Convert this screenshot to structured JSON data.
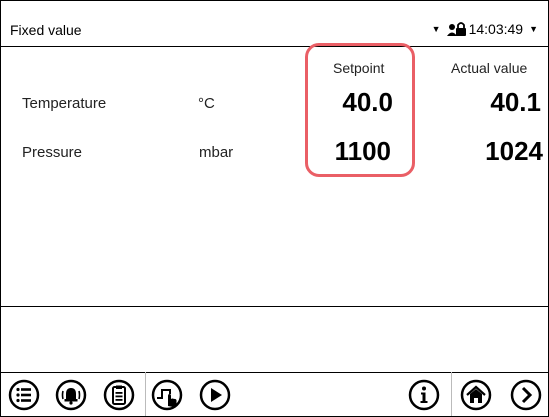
{
  "header": {
    "title": "Fixed value",
    "time": "14:03:49"
  },
  "table": {
    "col_setpoint": "Setpoint",
    "col_actual": "Actual value",
    "rows": [
      {
        "label": "Temperature",
        "unit": "°C",
        "setpoint": "40.0",
        "actual": "40.1"
      },
      {
        "label": "Pressure",
        "unit": "mbar",
        "setpoint": "1100",
        "actual": "1024"
      }
    ]
  },
  "colors": {
    "highlight": "#ea5f66"
  },
  "toolbar": {
    "icons": [
      "menu-icon",
      "alarm-icon",
      "clipboard-icon",
      "program-icon",
      "play-icon",
      "info-icon",
      "home-icon",
      "next-icon"
    ]
  }
}
